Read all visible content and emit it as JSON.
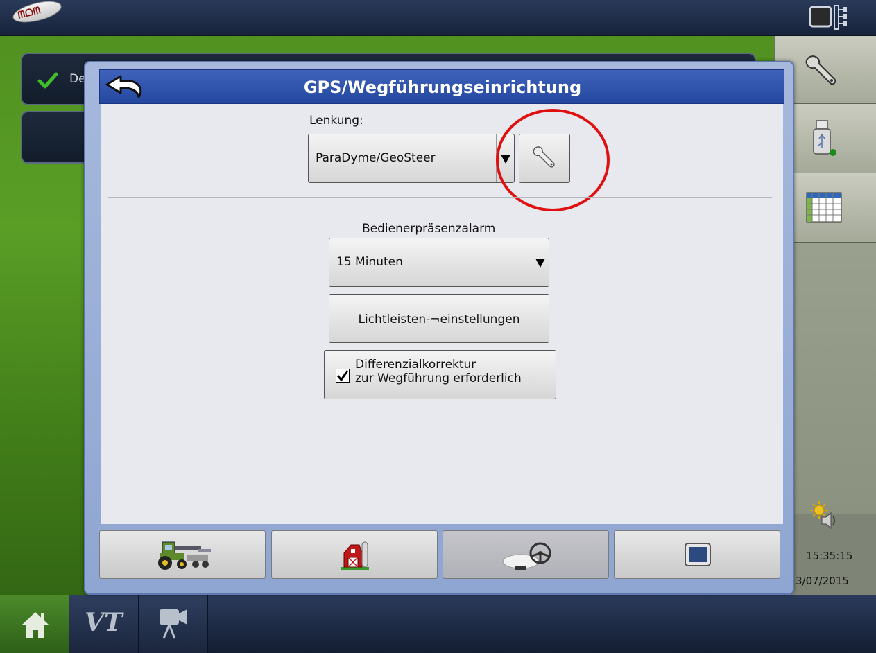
{
  "dialog": {
    "title": "GPS/Wegführungseinrichtung",
    "steering_label": "Lenkung:",
    "steering_value": "ParaDyme/GeoSteer",
    "operator_alarm_label": "Bedienerpräsenzalarm",
    "operator_alarm_value": "15 Minuten",
    "lightbar_button": "Lichtleisten-¬einstellungen",
    "diff_correction": {
      "line1": "Differenzialkorrektur",
      "line2": "zur Wegführung erforderlich",
      "checked": true
    },
    "tabs": [
      {
        "icon": "tractor-icon",
        "active": false
      },
      {
        "icon": "barn-icon",
        "active": false
      },
      {
        "icon": "gps-steering-icon",
        "active": true
      },
      {
        "icon": "display-icon",
        "active": false
      }
    ]
  },
  "background": {
    "row1_label": "De",
    "check_color": "#3fbf2a"
  },
  "status": {
    "time": "15:35:15",
    "date": "3/07/2015"
  },
  "sidebar_icons": [
    "wrench-icon",
    "usb-icon",
    "table-icon",
    "sun-speaker-icon"
  ],
  "bottom_bar": {
    "vt_label": "VT",
    "icons": [
      "home-icon",
      "vt-icon",
      "camera-icon"
    ]
  },
  "logo_text": "ᗰᗝᗰ",
  "highlight_color": "#e01010"
}
